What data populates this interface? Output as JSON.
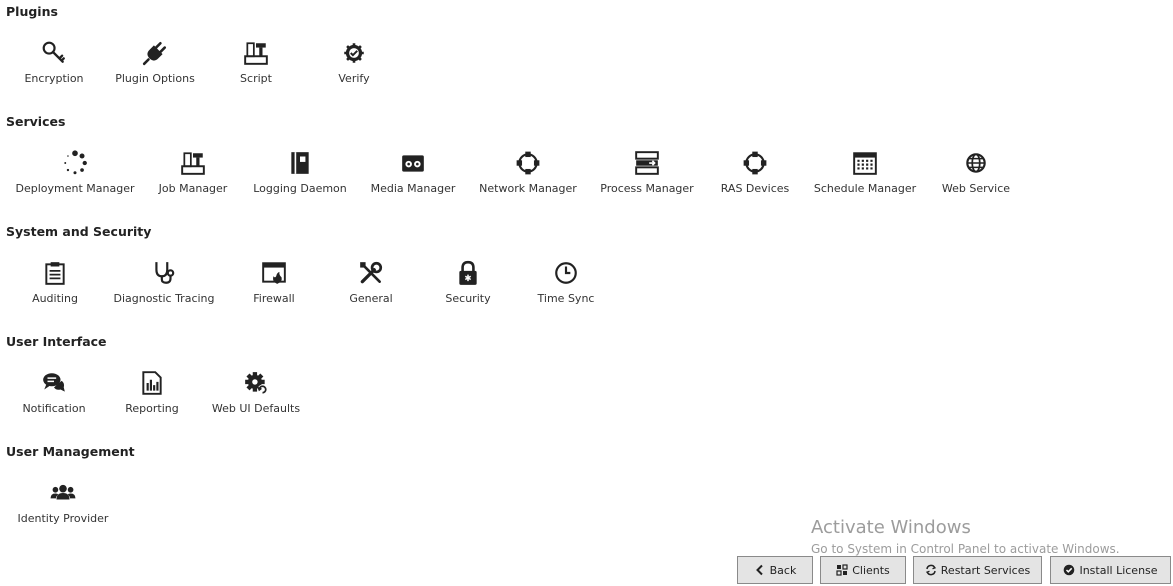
{
  "sections": {
    "plugins": {
      "title": "Plugins",
      "items": [
        {
          "label": "Encryption",
          "icon": "key-icon"
        },
        {
          "label": "Plugin Options",
          "icon": "plug-icon"
        },
        {
          "label": "Script",
          "icon": "script-icon"
        },
        {
          "label": "Verify",
          "icon": "verify-gear-icon"
        }
      ]
    },
    "services": {
      "title": "Services",
      "items": [
        {
          "label": "Deployment Manager",
          "icon": "spinner-icon"
        },
        {
          "label": "Job Manager",
          "icon": "job-icon"
        },
        {
          "label": "Logging Daemon",
          "icon": "book-icon"
        },
        {
          "label": "Media Manager",
          "icon": "tape-icon"
        },
        {
          "label": "Network Manager",
          "icon": "network-ring-icon"
        },
        {
          "label": "Process Manager",
          "icon": "process-icon"
        },
        {
          "label": "RAS Devices",
          "icon": "ras-ring-icon"
        },
        {
          "label": "Schedule Manager",
          "icon": "calendar-icon"
        },
        {
          "label": "Web Service",
          "icon": "globe-icon"
        }
      ]
    },
    "system_security": {
      "title": "System and Security",
      "items": [
        {
          "label": "Auditing",
          "icon": "clipboard-icon"
        },
        {
          "label": "Diagnostic Tracing",
          "icon": "stethoscope-icon"
        },
        {
          "label": "Firewall",
          "icon": "firewall-icon"
        },
        {
          "label": "General",
          "icon": "tools-icon"
        },
        {
          "label": "Security",
          "icon": "lock-icon"
        },
        {
          "label": "Time Sync",
          "icon": "clock-icon"
        }
      ]
    },
    "user_interface": {
      "title": "User Interface",
      "items": [
        {
          "label": "Notification",
          "icon": "chat-icon"
        },
        {
          "label": "Reporting",
          "icon": "report-icon"
        },
        {
          "label": "Web UI Defaults",
          "icon": "gear-refresh-icon"
        }
      ]
    },
    "user_management": {
      "title": "User Management",
      "items": [
        {
          "label": "Identity Provider",
          "icon": "users-icon"
        }
      ]
    }
  },
  "watermark": {
    "title": "Activate Windows",
    "subtitle": "Go to System in Control Panel to activate Windows."
  },
  "buttons": {
    "back": "Back",
    "clients": "Clients",
    "restart": "Restart Services",
    "install": "Install License"
  }
}
